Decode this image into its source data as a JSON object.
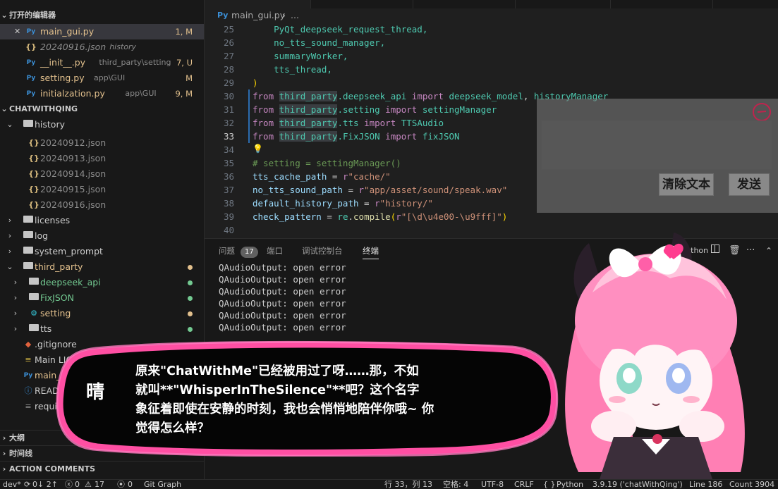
{
  "sidebar": {
    "open_editors_title": "打开的编辑器",
    "open_editors": [
      {
        "name": "main_gui.py",
        "desc": "",
        "badge": "1, M",
        "kind": "py",
        "color": "#e2c08d",
        "selected": true
      },
      {
        "name": "20240916.json",
        "desc": "history",
        "badge": "",
        "kind": "json",
        "color": "#8b8b8b",
        "italic": true
      },
      {
        "name": "__init__.py",
        "desc": "third_party\\setting",
        "badge": "7, U",
        "kind": "py",
        "color": "#e2c08d"
      },
      {
        "name": "setting.py",
        "desc": "app\\GUI",
        "badge": "M",
        "kind": "py",
        "color": "#e2c08d"
      },
      {
        "name": "initialzation.py",
        "desc": "app\\GUI",
        "badge": "9, M",
        "kind": "py",
        "color": "#e2c08d"
      }
    ],
    "project_title": "CHATWITHQING",
    "tree": [
      {
        "name": "history",
        "kind": "folder-open",
        "depth": 0,
        "color": "#cccccc"
      },
      {
        "name": "20240912.json",
        "kind": "json",
        "depth": 1,
        "color": "#8b8b8b"
      },
      {
        "name": "20240913.json",
        "kind": "json",
        "depth": 1,
        "color": "#8b8b8b"
      },
      {
        "name": "20240914.json",
        "kind": "json",
        "depth": 1,
        "color": "#8b8b8b"
      },
      {
        "name": "20240915.json",
        "kind": "json",
        "depth": 1,
        "color": "#8b8b8b"
      },
      {
        "name": "20240916.json",
        "kind": "json",
        "depth": 1,
        "color": "#8b8b8b"
      },
      {
        "name": "licenses",
        "kind": "folder",
        "depth": 0,
        "color": "#cccccc"
      },
      {
        "name": "log",
        "kind": "folder",
        "depth": 0,
        "color": "#cccccc"
      },
      {
        "name": "system_prompt",
        "kind": "folder",
        "depth": 0,
        "color": "#cccccc"
      },
      {
        "name": "third_party",
        "kind": "folder-open",
        "depth": 0,
        "color": "#e2c08d",
        "dot": "#e2c08d"
      },
      {
        "name": "deepseek_api",
        "kind": "folder",
        "depth": 1,
        "color": "#73c991",
        "dot": "#73c991"
      },
      {
        "name": "FixJSON",
        "kind": "folder",
        "depth": 1,
        "color": "#73c991",
        "dot": "#73c991"
      },
      {
        "name": "setting",
        "kind": "folder-gear",
        "depth": 1,
        "color": "#e2c08d",
        "dot": "#e2c08d"
      },
      {
        "name": "tts",
        "kind": "folder",
        "depth": 1,
        "color": "#cccccc",
        "dot": "#73c991"
      },
      {
        "name": ".gitignore",
        "kind": "git",
        "depth": 0,
        "color": "#cccccc"
      },
      {
        "name": "Main LICENSE",
        "kind": "license",
        "depth": 0,
        "color": "#cccccc"
      },
      {
        "name": "main_gui.py",
        "kind": "py",
        "depth": 0,
        "color": "#e2c08d"
      },
      {
        "name": "README.md",
        "kind": "info",
        "depth": 0,
        "color": "#cccccc"
      },
      {
        "name": "requirements.txt",
        "kind": "txt",
        "depth": 0,
        "color": "#cccccc"
      }
    ],
    "outline_title": "大纲",
    "timeline_title": "时间线",
    "action_comments_title": "ACTION COMMENTS"
  },
  "breadcrumb": {
    "file": "main_gui.py",
    "sep": "›",
    "rest": "..."
  },
  "editor": {
    "lines": [
      {
        "n": "25",
        "tokens": [
          [
            "    PyQt_deepseek_request_thread,",
            "mod"
          ]
        ]
      },
      {
        "n": "26",
        "tokens": [
          [
            "    no_tts_sound_manager,",
            "mod"
          ]
        ]
      },
      {
        "n": "27",
        "tokens": [
          [
            "    summaryWorker,",
            "mod"
          ]
        ]
      },
      {
        "n": "28",
        "tokens": [
          [
            "    tts_thread,",
            "mod"
          ]
        ]
      },
      {
        "n": "29",
        "tokens": [
          [
            ")",
            "brk"
          ]
        ]
      },
      {
        "n": "30",
        "tokens": [
          [
            "from ",
            "kw"
          ],
          [
            "third_party",
            "mod hl"
          ],
          [
            ".deepseek_api ",
            "mod"
          ],
          [
            "import ",
            "kw"
          ],
          [
            "deepseek_model",
            "mod"
          ],
          [
            ", ",
            "plain"
          ],
          [
            "historyManager",
            "mod"
          ]
        ],
        "mark": true
      },
      {
        "n": "31",
        "tokens": [
          [
            "from ",
            "kw"
          ],
          [
            "third_party",
            "mod hl"
          ],
          [
            ".setting ",
            "mod"
          ],
          [
            "import ",
            "kw"
          ],
          [
            "settingManager",
            "mod"
          ]
        ],
        "mark": true
      },
      {
        "n": "32",
        "tokens": [
          [
            "from ",
            "kw"
          ],
          [
            "third_party",
            "mod hl"
          ],
          [
            ".tts ",
            "mod"
          ],
          [
            "import ",
            "kw"
          ],
          [
            "TTSAudio",
            "mod"
          ]
        ],
        "mark": true
      },
      {
        "n": "33",
        "tokens": [
          [
            "from ",
            "kw"
          ],
          [
            "third_party",
            "mod hl"
          ],
          [
            ".FixJSON ",
            "mod"
          ],
          [
            "import ",
            "kw"
          ],
          [
            "fixJSON",
            "mod"
          ]
        ],
        "mark": true,
        "current": true
      },
      {
        "n": "34",
        "tokens": [
          [
            "",
            "plain"
          ]
        ],
        "bulb": true
      },
      {
        "n": "35",
        "tokens": [
          [
            "# setting = settingManager()",
            "cmt"
          ]
        ]
      },
      {
        "n": "36",
        "tokens": [
          [
            "tts_cache_path",
            "var"
          ],
          [
            " = ",
            "plain"
          ],
          [
            "r",
            "kw"
          ],
          [
            "\"cache/\"",
            "str"
          ]
        ]
      },
      {
        "n": "37",
        "tokens": [
          [
            "no_tts_sound_path",
            "var"
          ],
          [
            " = ",
            "plain"
          ],
          [
            "r",
            "kw"
          ],
          [
            "\"app/asset/sound/speak.wav\"",
            "str"
          ]
        ]
      },
      {
        "n": "38",
        "tokens": [
          [
            "default_history_path",
            "var"
          ],
          [
            " = ",
            "plain"
          ],
          [
            "r",
            "kw"
          ],
          [
            "\"history/\"",
            "str"
          ]
        ]
      },
      {
        "n": "39",
        "tokens": [
          [
            "check_pattern",
            "var"
          ],
          [
            " = ",
            "plain"
          ],
          [
            "re",
            "mod"
          ],
          [
            ".",
            "plain"
          ],
          [
            "compile",
            "fn"
          ],
          [
            "(",
            "brk"
          ],
          [
            "r",
            "kw"
          ],
          [
            "\"[\\d\\u4e00-\\u9fff]\"",
            "str"
          ],
          [
            ")",
            "brk"
          ]
        ]
      },
      {
        "n": "40",
        "tokens": [
          [
            "",
            "plain"
          ]
        ]
      }
    ]
  },
  "app_overlay": {
    "clear_button": "清除文本",
    "send_button": "发送"
  },
  "panel": {
    "tabs": [
      {
        "label": "问题",
        "count": "17"
      },
      {
        "label": "端口"
      },
      {
        "label": "调试控制台"
      },
      {
        "label": "终端",
        "active": true
      }
    ],
    "shell_label": "Python",
    "terminal_lines": [
      "QAudioOutput: open error",
      "QAudioOutput: open error",
      "QAudioOutput: open error",
      "QAudioOutput: open error",
      "QAudioOutput: open error",
      "QAudioOutput: open error"
    ]
  },
  "dialog": {
    "speaker": "晴",
    "lines": [
      "原来\"ChatWithMe\"已经被用过了呀……那，不如",
      "就叫**\"WhisperInTheSilence\"**吧？这个名字",
      "象征着即使在安静的时刻，我也会悄悄地陪伴你哦~ 你",
      "觉得怎么样？"
    ]
  },
  "status": {
    "branch": "dev*",
    "sync": "0↓ 2↑",
    "errors": "0",
    "warnings": "17",
    "ports": "0",
    "git_graph": "Git Graph",
    "position": "行 33，列 13",
    "spaces": "空格: 4",
    "encoding": "UTF-8",
    "eol": "CRLF",
    "language": "Python",
    "interpreter": "3.9.19 ('chatWithQing')",
    "line_count": "Line 186",
    "count": "Count 3904"
  },
  "colors": {
    "accent_pink": "#ff4fa3",
    "bubble_bg": "#050505",
    "modified": "#e2c08d",
    "untracked": "#73c991"
  }
}
